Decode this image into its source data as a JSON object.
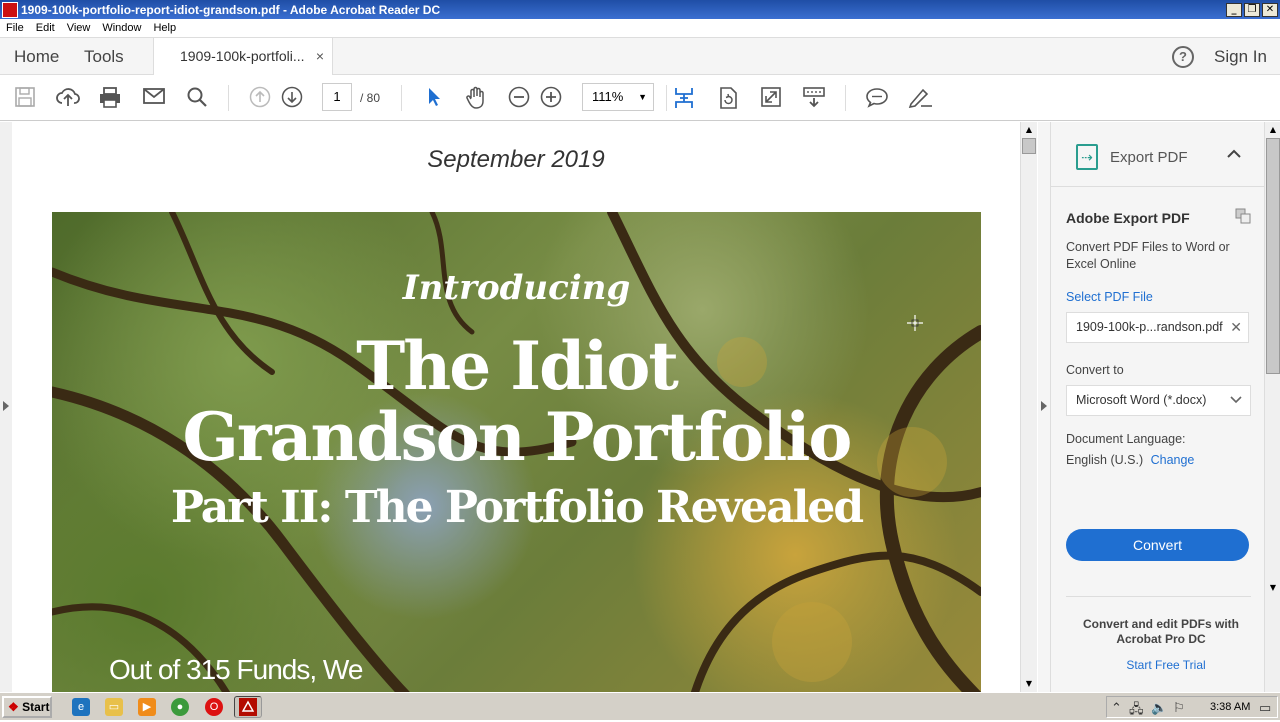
{
  "window": {
    "title": "1909-100k-portfolio-report-idiot-grandson.pdf - Adobe Acrobat Reader DC",
    "buttons": [
      "_",
      "❐",
      "✕"
    ]
  },
  "menu": [
    "File",
    "Edit",
    "View",
    "Window",
    "Help"
  ],
  "tabs": {
    "home": "Home",
    "tools": "Tools",
    "doc": "1909-100k-portfoli...",
    "close": "×",
    "signin": "Sign In",
    "help": "?"
  },
  "toolbar": {
    "icons": [
      "save-icon",
      "upload-icon",
      "print-icon",
      "email-icon",
      "search-icon",
      "prev-page-icon",
      "next-page-icon",
      "select-tool-icon",
      "hand-tool-icon",
      "zoom-out-icon",
      "zoom-in-icon",
      "fit-page-icon",
      "rotate-icon",
      "fullscreen-icon",
      "scroll-mode-icon",
      "comment-icon",
      "sign-icon"
    ],
    "page_current": "1",
    "page_total": "/ 80",
    "zoom": "111%"
  },
  "document": {
    "date": "September 2019",
    "intro": "Introducing",
    "title_line1": "The Idiot",
    "title_line2": "Grandson Portfolio",
    "title_line3": "Part II: The Portfolio Revealed",
    "subtitle": "Out of 315 Funds, We"
  },
  "export_panel": {
    "header": "Export PDF",
    "heading": "Adobe Export PDF",
    "description": "Convert PDF Files to Word or Excel Online",
    "select_label": "Select PDF File",
    "file_value": "1909-100k-p...randson.pdf",
    "convert_to_label": "Convert to",
    "convert_to_value": "Microsoft Word (*.docx)",
    "language_label": "Document Language:",
    "language_value": "English (U.S.)",
    "change_link": "Change",
    "convert_button": "Convert",
    "promo": "Convert and edit PDFs with Acrobat Pro DC",
    "trial_link": "Start Free Trial"
  },
  "taskbar": {
    "start_label": "Start",
    "clock": "3:38 AM"
  },
  "colors": {
    "accent": "#1f6fd1",
    "export_icon": "#2a9d8f",
    "titlebar": "#1f4ea6"
  }
}
